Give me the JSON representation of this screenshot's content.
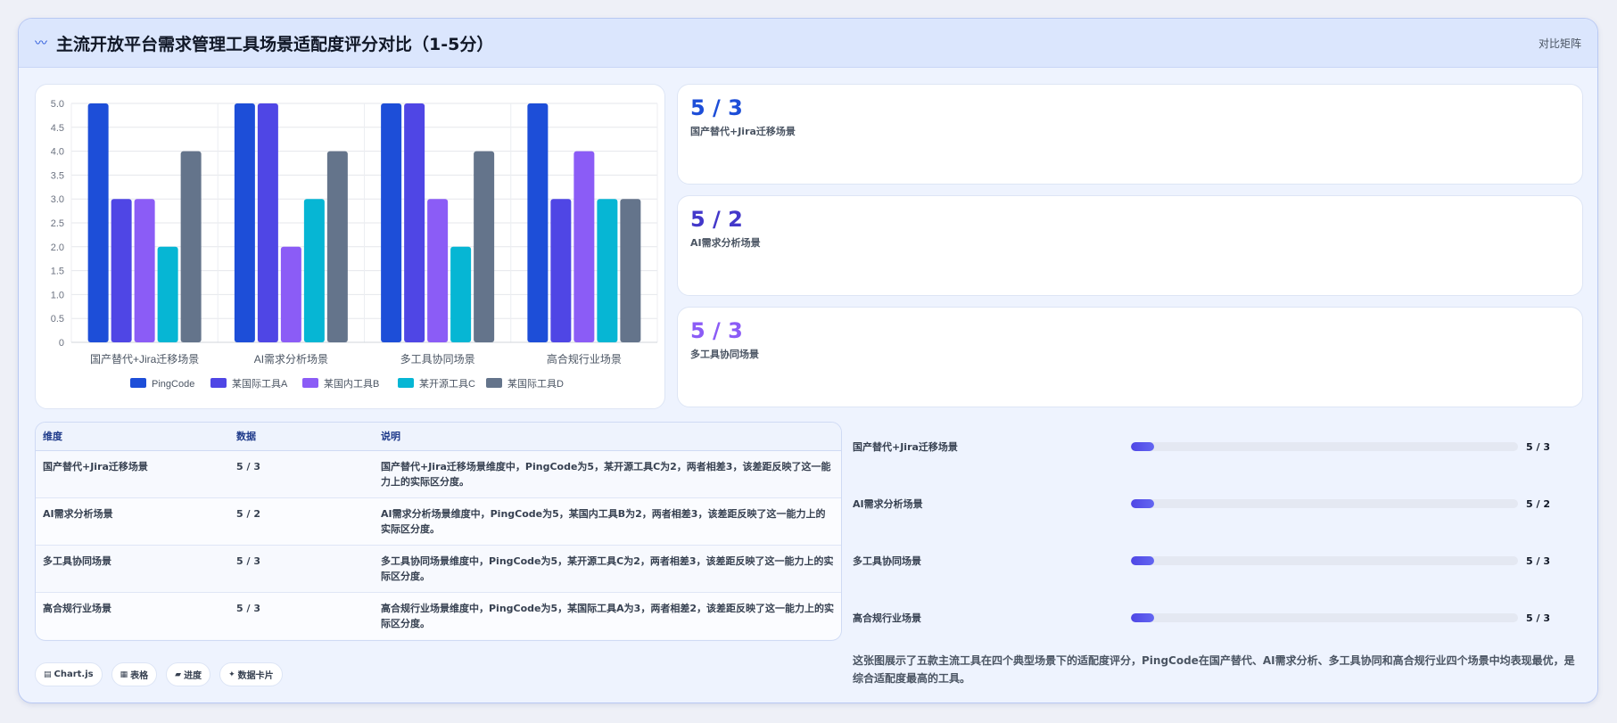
{
  "header": {
    "title": "主流开放平台需求管理工具场景适配度评分对比（1-5分）",
    "tag": "对比矩阵",
    "icon": "wave-icon"
  },
  "colors": {
    "PingCode": "#1d4ed8",
    "某国际工具A": "#4f46e5",
    "某国内工具B": "#8b5cf6",
    "某开源工具C": "#06b6d4",
    "某国际工具D": "#64748b"
  },
  "chart_data": {
    "type": "bar",
    "categories": [
      "国产替代+Jira迁移场景",
      "AI需求分析场景",
      "多工具协同场景",
      "高合规行业场景"
    ],
    "series": [
      {
        "name": "PingCode",
        "values": [
          5,
          5,
          5,
          5
        ]
      },
      {
        "name": "某国际工具A",
        "values": [
          3,
          5,
          5,
          3
        ]
      },
      {
        "name": "某国内工具B",
        "values": [
          3,
          2,
          3,
          4
        ]
      },
      {
        "name": "某开源工具C",
        "values": [
          2,
          3,
          2,
          3
        ]
      },
      {
        "name": "某国际工具D",
        "values": [
          4,
          4,
          4,
          3
        ]
      }
    ],
    "yticks": [
      "0",
      "0.5",
      "1.0",
      "1.5",
      "2.0",
      "2.5",
      "3.0",
      "3.5",
      "4.0",
      "4.5",
      "5.0"
    ],
    "ylim": [
      0,
      5
    ],
    "grid": true,
    "legend": "bottom"
  },
  "stats": [
    {
      "value": "5 / 3",
      "label": "国产替代+Jira迁移场景",
      "color": "#1d4ed8"
    },
    {
      "value": "5 / 2",
      "label": "AI需求分析场景",
      "color": "#4338ca"
    },
    {
      "value": "5 / 3",
      "label": "多工具协同场景",
      "color": "#8b5cf6"
    }
  ],
  "table": {
    "headers": [
      "维度",
      "数据",
      "说明"
    ],
    "rows": [
      {
        "dim": "国产替代+Jira迁移场景",
        "data": "5 / 3",
        "desc": "国产替代+Jira迁移场景维度中，PingCode为5，某开源工具C为2，两者相差3，该差距反映了这一能力上的实际区分度。"
      },
      {
        "dim": "AI需求分析场景",
        "data": "5 / 2",
        "desc": "AI需求分析场景维度中，PingCode为5，某国内工具B为2，两者相差3，该差距反映了这一能力上的实际区分度。"
      },
      {
        "dim": "多工具协同场景",
        "data": "5 / 3",
        "desc": "多工具协同场景维度中，PingCode为5，某开源工具C为2，两者相差3，该差距反映了这一能力上的实际区分度。"
      },
      {
        "dim": "高合规行业场景",
        "data": "5 / 3",
        "desc": "高合规行业场景维度中，PingCode为5，某国际工具A为3，两者相差2，该差距反映了这一能力上的实际区分度。"
      }
    ]
  },
  "progress": [
    {
      "label": "国产替代+Jira迁移场景",
      "value": "5 / 3",
      "fraction": 0.06
    },
    {
      "label": "AI需求分析场景",
      "value": "5 / 2",
      "fraction": 0.06
    },
    {
      "label": "多工具协同场景",
      "value": "5 / 3",
      "fraction": 0.06
    },
    {
      "label": "高合规行业场景",
      "value": "5 / 3",
      "fraction": 0.06
    }
  ],
  "chips": [
    {
      "icon": "chart-icon",
      "glyph": "▤",
      "label": "Chart.js"
    },
    {
      "icon": "table-icon",
      "glyph": "▦",
      "label": "表格"
    },
    {
      "icon": "progress-icon",
      "glyph": "▰",
      "label": "进度"
    },
    {
      "icon": "card-icon",
      "glyph": "✦",
      "label": "数据卡片"
    }
  ],
  "summary": "这张图展示了五款主流工具在四个典型场景下的适配度评分，PingCode在国产替代、AI需求分析、多工具协同和高合规行业四个场景中均表现最优，是综合适配度最高的工具。"
}
